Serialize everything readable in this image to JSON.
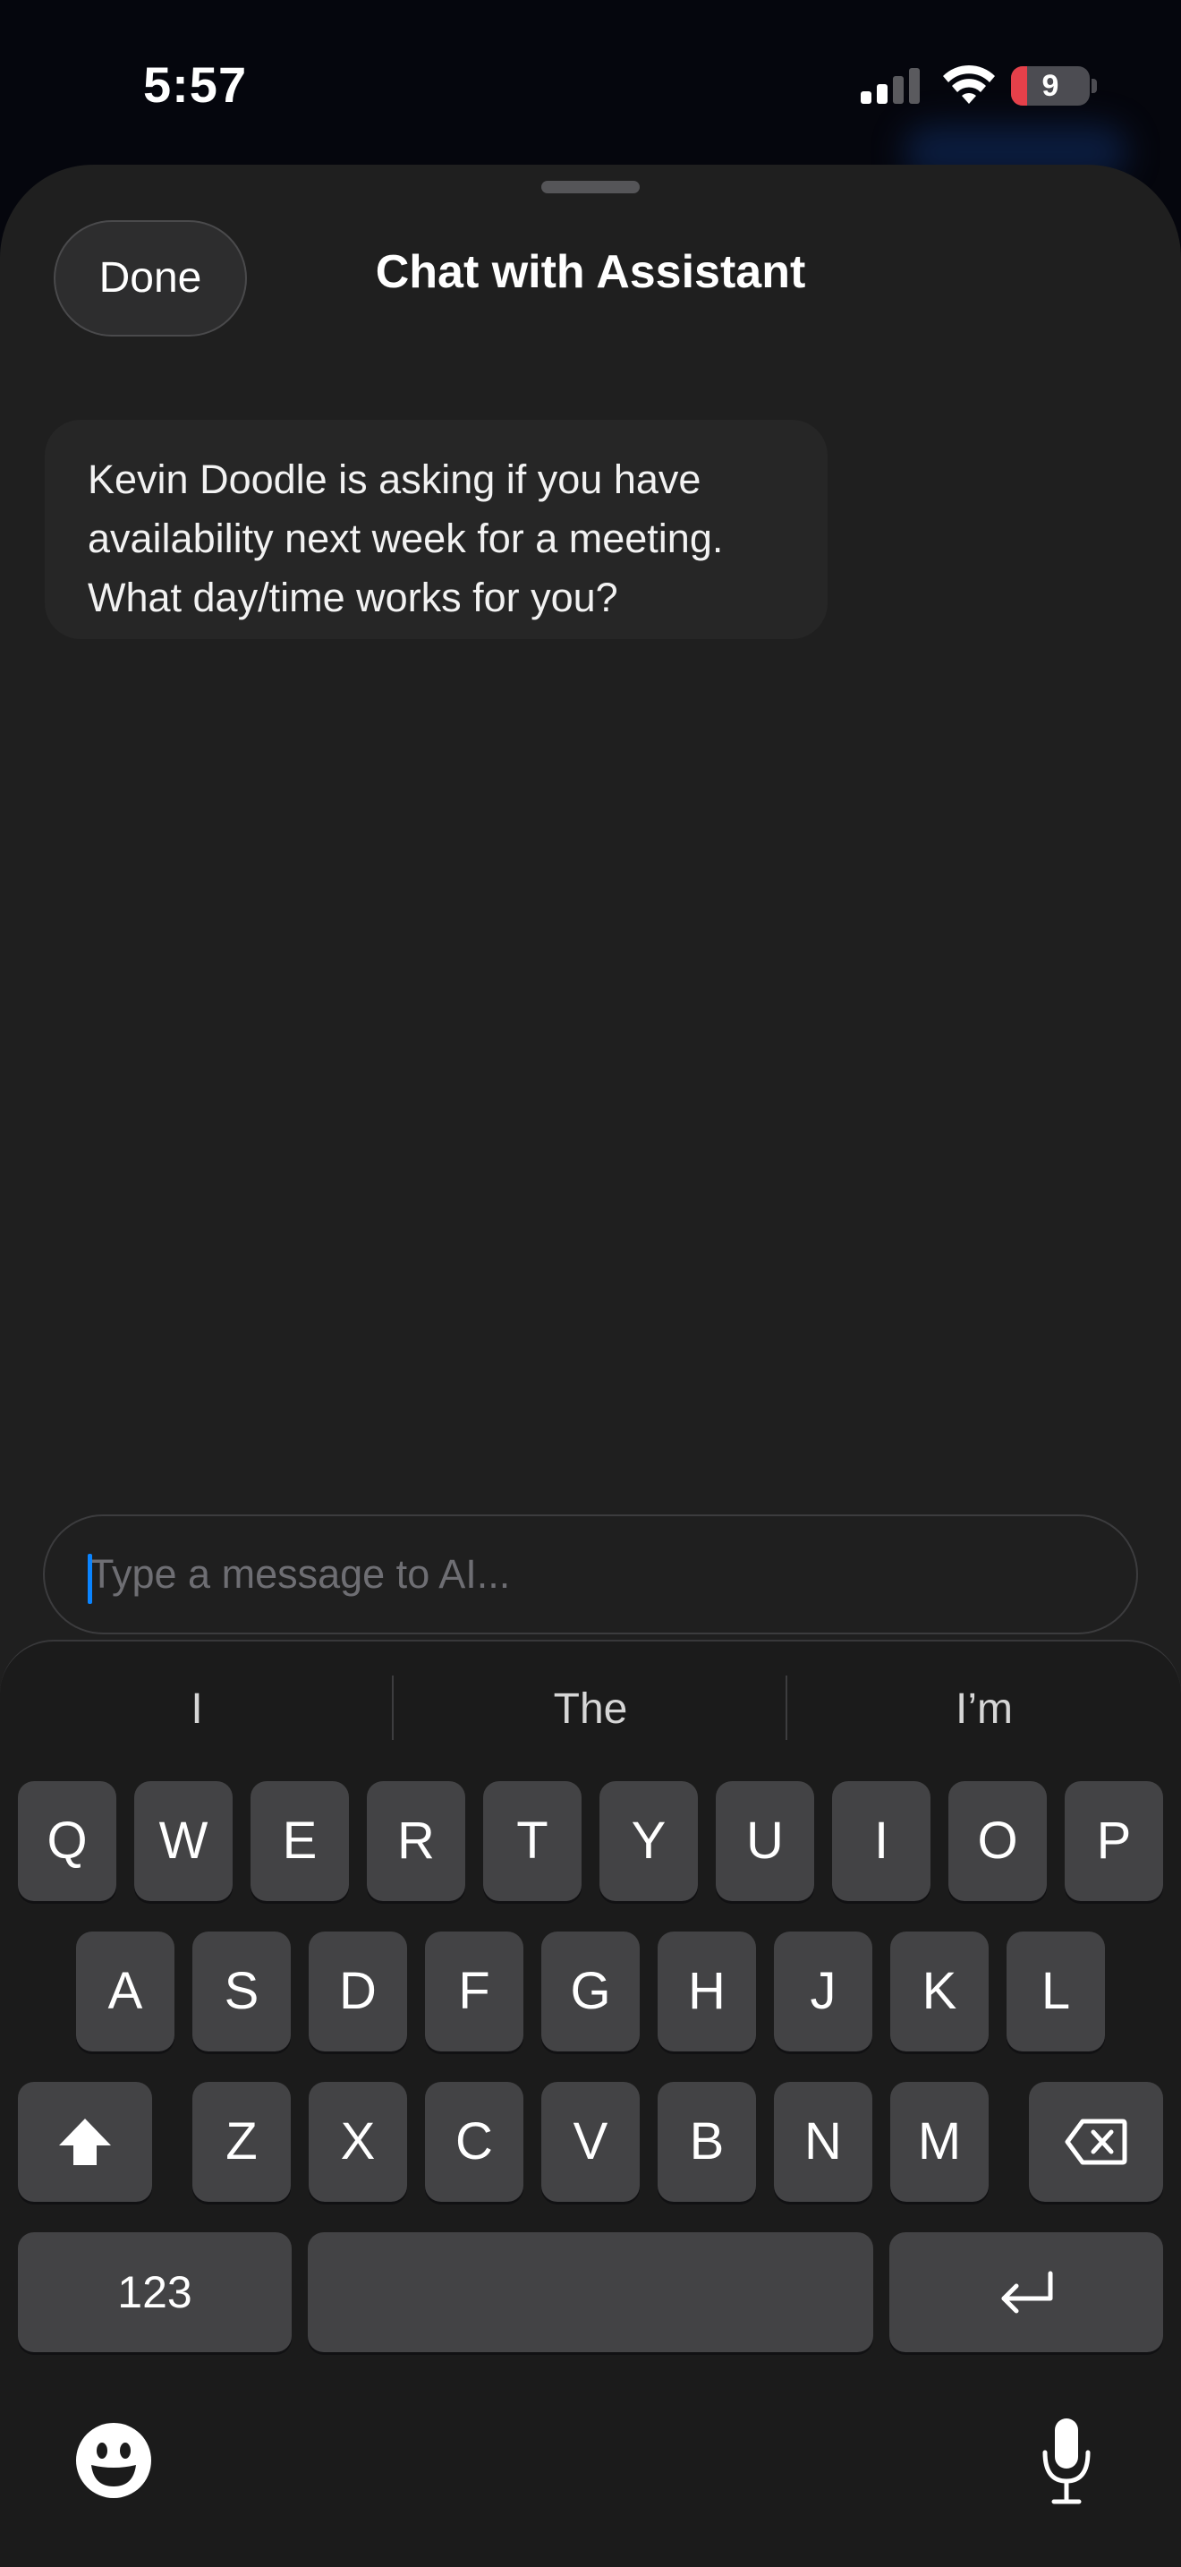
{
  "status_bar": {
    "time": "5:57",
    "battery_level": "9",
    "battery_fraction": 0.09,
    "signal_bars_active": 2,
    "signal_bars_total": 4,
    "icons": [
      "cellular-signal-icon",
      "wifi-icon",
      "battery-icon"
    ]
  },
  "sheet": {
    "done_label": "Done",
    "title": "Chat with Assistant"
  },
  "chat": {
    "messages": [
      {
        "role": "assistant",
        "lines": [
          "Kevin Doodle is asking if you have",
          "availability next week for a meeting.",
          "What day/time works for you?"
        ]
      }
    ]
  },
  "composer": {
    "placeholder": "Type a message to AI..."
  },
  "keyboard": {
    "suggestions": [
      "I",
      "The",
      "I’m"
    ],
    "row1": [
      "Q",
      "W",
      "E",
      "R",
      "T",
      "Y",
      "U",
      "I",
      "O",
      "P"
    ],
    "row2": [
      "A",
      "S",
      "D",
      "F",
      "G",
      "H",
      "J",
      "K",
      "L"
    ],
    "row3": [
      "Z",
      "X",
      "C",
      "V",
      "B",
      "N",
      "M"
    ],
    "numbers_label": "123",
    "icons": [
      "shift-icon",
      "backspace-icon",
      "return-icon",
      "emoji-icon",
      "microphone-icon"
    ]
  },
  "colors": {
    "accent": "#0a84ff",
    "battery_low": "#e5404a",
    "sheet_bg": "#1f1f1f",
    "key_bg": "#434345"
  }
}
